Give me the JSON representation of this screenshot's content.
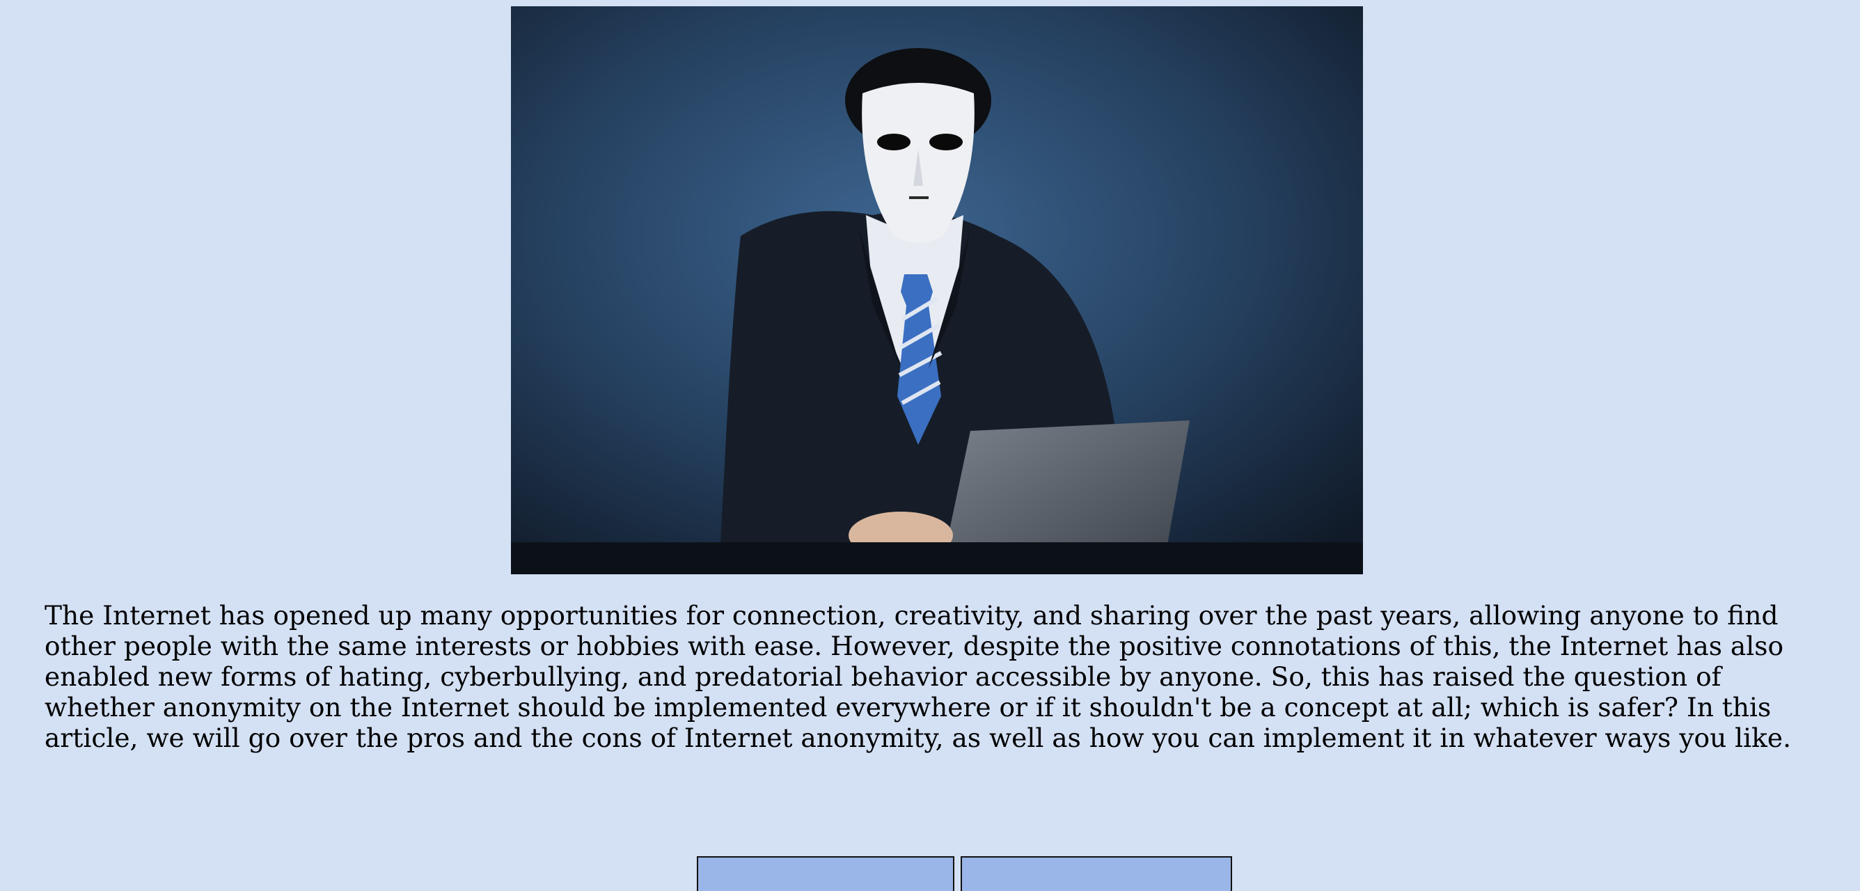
{
  "hero_image": {
    "icon": "masked-person-at-laptop-image",
    "colors": {
      "background": "#2a4b6e",
      "suit": "#161d28",
      "mask": "#eef0f3",
      "tie": "#3b6fc2",
      "desk": "#0c1118",
      "laptop": "#5b626c"
    }
  },
  "article": {
    "intro_text": "The Internet has opened up many opportunities for connection, creativity, and sharing over the past years, allowing anyone to find other people with the same interests or hobbies with ease. However, despite the positive connotations of this, the Internet has also enabled new forms of hating, cyberbullying, and predatorial behavior accessible by anyone. So, this has raised the question of whether anonymity on the Internet should be implemented everywhere or if it shouldn't be a concept at all; which is safer? In this article, we will go over the pros and the cons of Internet anonymity, as well as how you can implement it in whatever ways you like."
  },
  "nav": {
    "left_label": "",
    "right_label": ""
  },
  "colors": {
    "page_background": "#d4e0f4",
    "button_background": "#9ab5e8",
    "button_border": "#111111"
  }
}
